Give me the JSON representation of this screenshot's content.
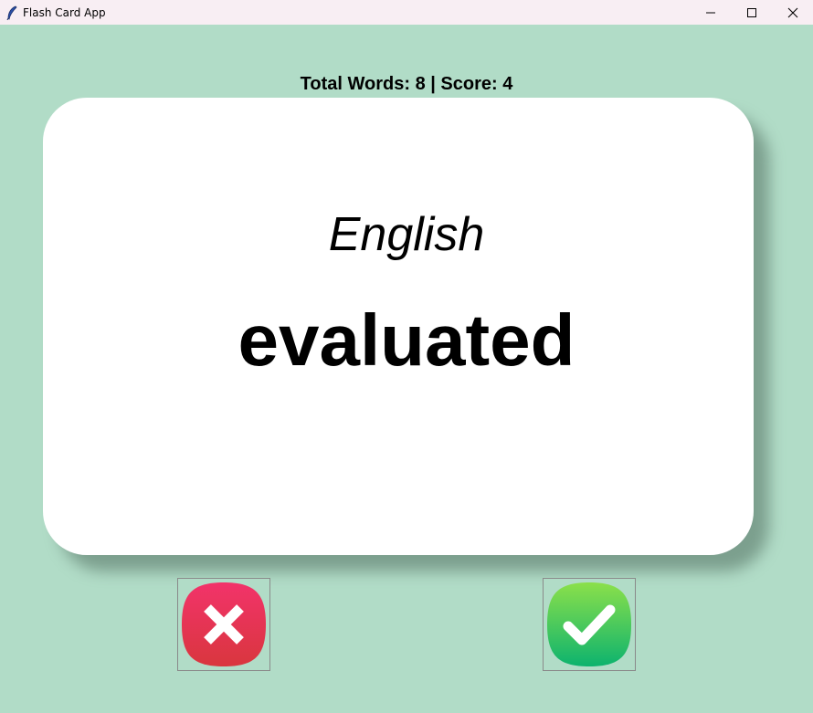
{
  "window": {
    "title": "Flash Card App",
    "controls": [
      "minimize",
      "maximize",
      "close"
    ]
  },
  "header": {
    "score_text": "Total Words: 8 | Score: 4"
  },
  "card": {
    "language": "English",
    "word": "evaluated"
  },
  "buttons": {
    "wrong": {
      "icon": "x-icon",
      "color": "#e63355"
    },
    "right": {
      "icon": "check-icon",
      "color": "#2ec45c"
    }
  },
  "colors": {
    "background": "#b1dcc7",
    "card": "#ffffff",
    "titlebar": "#f8eef3"
  }
}
